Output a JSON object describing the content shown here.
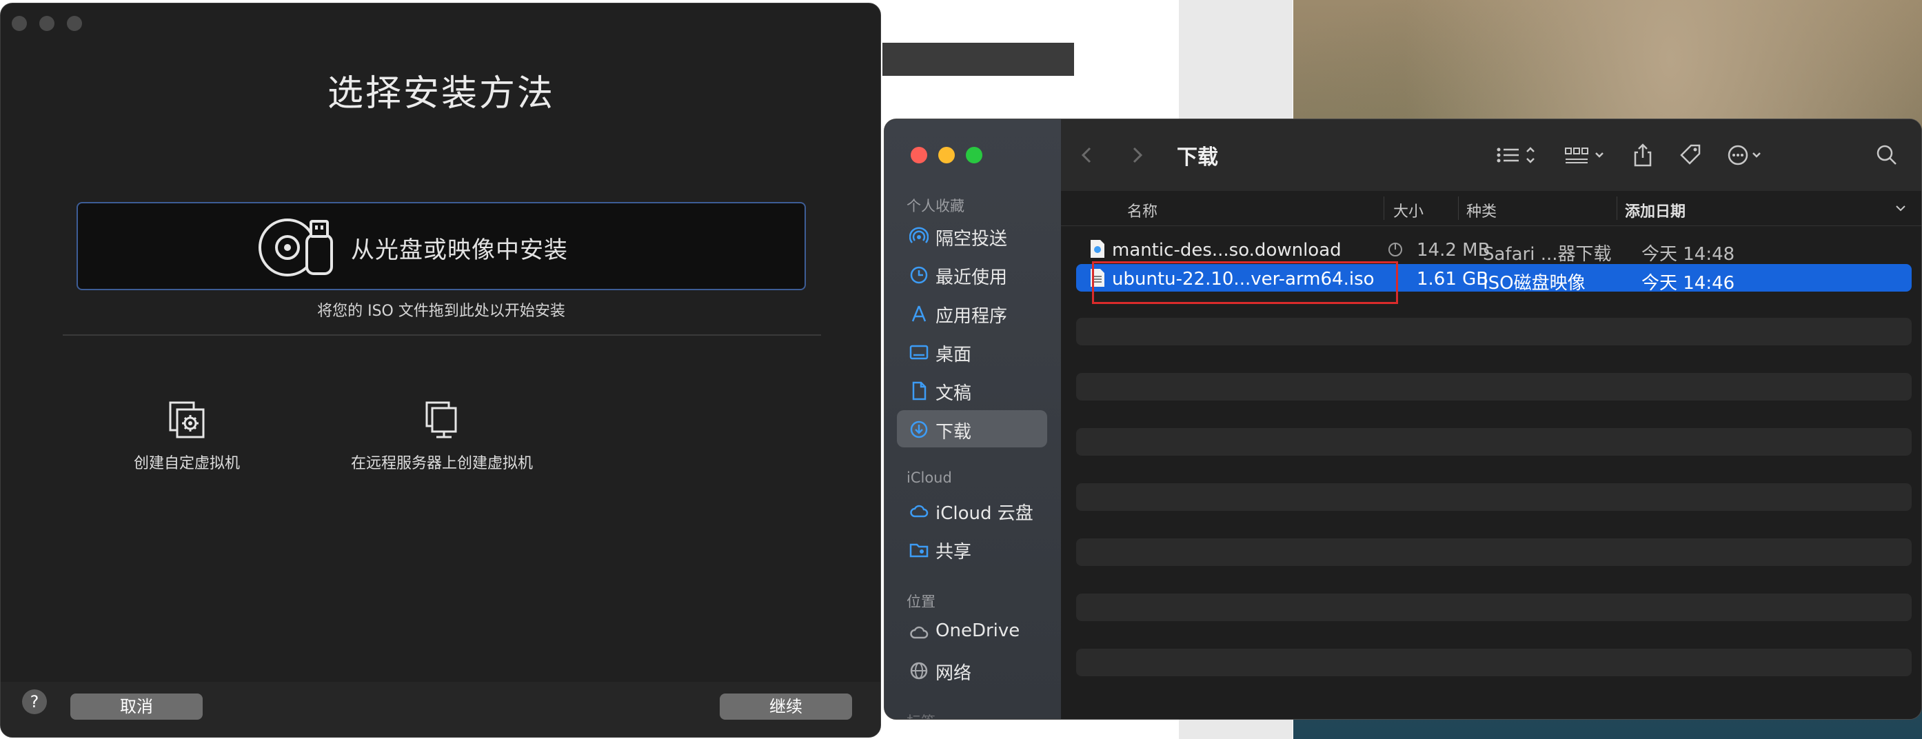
{
  "installer": {
    "title": "选择安装方法",
    "drop_label": "从光盘或映像中安装",
    "drop_hint": "将您的 ISO 文件拖到此处以开始安装",
    "options": [
      {
        "label": "创建自定虚拟机",
        "icon": "custom-vm-icon"
      },
      {
        "label": "在远程服务器上创建虚拟机",
        "icon": "remote-server-icon"
      }
    ],
    "help_label": "?",
    "cancel_label": "取消",
    "continue_label": "继续"
  },
  "finder": {
    "title": "下载",
    "sidebar": {
      "favorites_header": "个人收藏",
      "favorites": [
        {
          "label": "隔空投送",
          "icon": "airdrop-icon"
        },
        {
          "label": "最近使用",
          "icon": "clock-icon"
        },
        {
          "label": "应用程序",
          "icon": "applications-icon"
        },
        {
          "label": "桌面",
          "icon": "desktop-icon"
        },
        {
          "label": "文稿",
          "icon": "document-icon"
        },
        {
          "label": "下载",
          "icon": "download-icon",
          "active": true
        }
      ],
      "icloud_header": "iCloud",
      "icloud": [
        {
          "label": "iCloud 云盘",
          "icon": "cloud-icon"
        },
        {
          "label": "共享",
          "icon": "shared-folder-icon"
        }
      ],
      "locations_header": "位置",
      "locations": [
        {
          "label": "OneDrive",
          "icon": "cloud-outline-icon"
        },
        {
          "label": "网络",
          "icon": "globe-icon"
        }
      ],
      "tags_header_partial": "标签"
    },
    "columns": {
      "name": "名称",
      "size": "大小",
      "kind": "种类",
      "date_added": "添加日期"
    },
    "files": [
      {
        "name": "mantic-des...so.download",
        "size": "14.2 MB",
        "kind": "Safari ...器下载",
        "date": "今天 14:48",
        "selected": false
      },
      {
        "name": "ubuntu-22.10...ver-arm64.iso",
        "size": "1.61 GB",
        "kind": "ISO磁盘映像",
        "date": "今天 14:46",
        "selected": true
      }
    ],
    "colors": {
      "selection": "#1764dc",
      "highlight_box": "#d92b2b",
      "traffic_close": "#fe5f57",
      "traffic_min": "#febc2e",
      "traffic_max": "#28c840"
    }
  }
}
